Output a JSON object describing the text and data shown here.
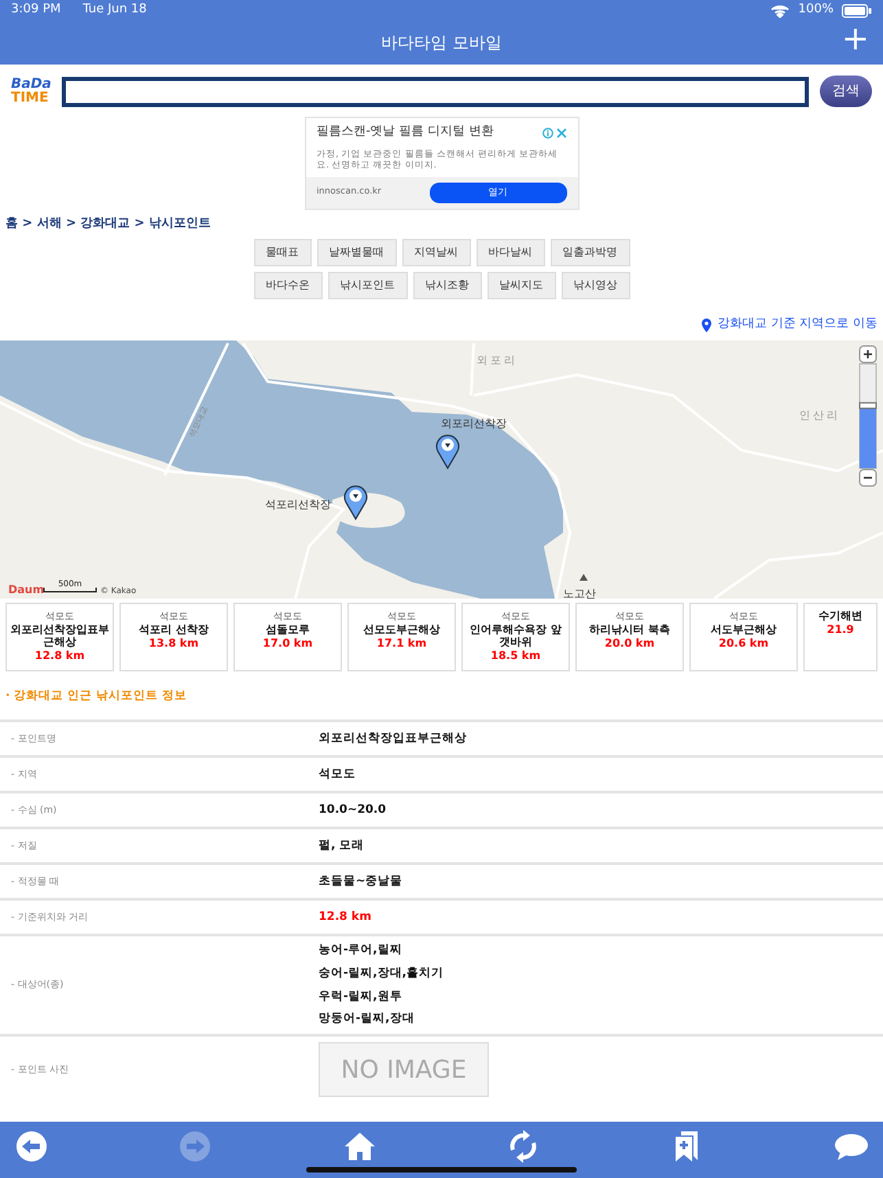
{
  "status_bar": {
    "time": "3:09 PM",
    "date": "Tue Jun 18",
    "battery": "100%"
  },
  "header": {
    "title": "바다타임 모바일",
    "add_button": "+"
  },
  "search": {
    "logo_top": "BaDa",
    "logo_bottom": "TIME",
    "button": "검색"
  },
  "ad": {
    "title": "필름스캔-옛날 필름 디지털 변환",
    "description": "가정, 기업 보관중인 필름들 스캔해서 편리하게 보관하세요. 선명하고 깨끗한 이미지.",
    "domain": "innoscan.co.kr",
    "button": "열기"
  },
  "breadcrumb": "홈 > 서해 > 강화대교 > 낚시포인트",
  "menu_rows": [
    [
      "물때표",
      "날짜별물때",
      "지역날씨",
      "바다날씨",
      "일출과박명"
    ],
    [
      "바다수온",
      "낚시포인트",
      "낚시조황",
      "날씨지도",
      "낚시영상"
    ]
  ],
  "location_link": "강화대교 기준 지역으로 이동",
  "map": {
    "labels": [
      {
        "kind": "village",
        "text": "외포리"
      },
      {
        "kind": "village",
        "text": "인산리"
      },
      {
        "kind": "pier",
        "text": "외포리선착장"
      },
      {
        "kind": "pier",
        "text": "석포리선착장"
      },
      {
        "kind": "bridge",
        "text": "석모대교"
      },
      {
        "kind": "mountain",
        "text": "노고산"
      }
    ],
    "zoom": {
      "level": 0.6
    },
    "logo": "Daum",
    "scale": "500m",
    "copyright": "© Kakao"
  },
  "points": [
    {
      "region": "석모도",
      "name": "외포리선착장입표부근해상",
      "distance": "12.8 km"
    },
    {
      "region": "석모도",
      "name": "석포리 선착장",
      "distance": "13.8 km"
    },
    {
      "region": "석모도",
      "name": "섬돌모루",
      "distance": "17.0 km"
    },
    {
      "region": "석모도",
      "name": "선모도부근해상",
      "distance": "17.1 km"
    },
    {
      "region": "석모도",
      "name": "인어루해수욕장 앞 갯바위",
      "distance": "18.5 km"
    },
    {
      "region": "석모도",
      "name": "하리낚시터 북측",
      "distance": "20.0 km"
    },
    {
      "region": "석모도",
      "name": "서도부근해상",
      "distance": "20.6 km"
    },
    {
      "name": "수기해변",
      "distance": "21.9"
    }
  ],
  "info_heading": "· 강화대교 인근 낚시포인트 정보",
  "info_rows": [
    {
      "kind": "text",
      "label": "- 포인트명",
      "value": "외포리선착장입표부근해상"
    },
    {
      "kind": "text",
      "label": "- 지역",
      "value": "석모도"
    },
    {
      "kind": "text",
      "label": "- 수심 (m)",
      "value": "10.0~20.0"
    },
    {
      "kind": "text",
      "label": "- 저질",
      "value": "펄, 모래"
    },
    {
      "kind": "text",
      "label": "- 적정물 때",
      "value": "초들물~중날물"
    },
    {
      "kind": "distance",
      "label": "- 기준위치와 거리",
      "value": "12.8 km"
    },
    {
      "kind": "list",
      "label": "- 대상어(종)",
      "values": [
        "농어-루어,릴찌",
        "숭어-릴찌,장대,훌치기",
        "우럭-릴찌,원투",
        "망둥어-릴찌,장대"
      ]
    },
    {
      "kind": "photo",
      "label": "- 포인트 사진",
      "value": "NO IMAGE"
    }
  ],
  "toolbar": [
    {
      "kind": "back",
      "disabled": false
    },
    {
      "kind": "forward",
      "disabled": true
    },
    {
      "kind": "home",
      "disabled": false
    },
    {
      "kind": "refresh",
      "disabled": false
    },
    {
      "kind": "bookmark",
      "disabled": false
    },
    {
      "kind": "chat",
      "disabled": false
    }
  ]
}
